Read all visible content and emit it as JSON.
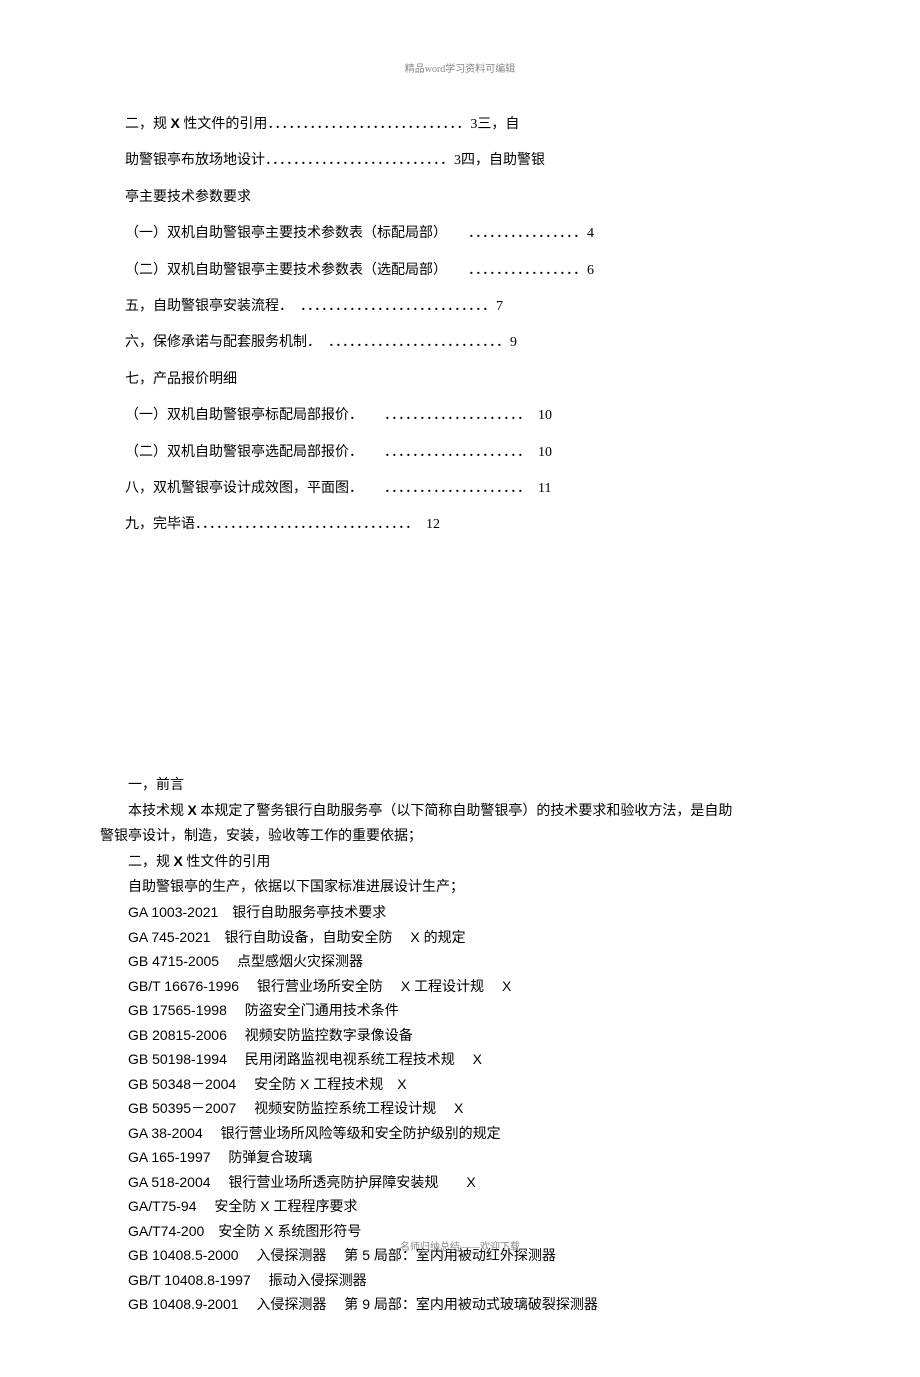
{
  "header": "精品word学习资料可编辑",
  "footer": "名师归纳总结——欢迎下载",
  "toc": {
    "flow1_a": "二，规 ",
    "flow1_x": "X",
    "flow1_b": " 性文件的引用．．．．．．．．．．．．．．．．．．．．．．．．．．．．3三，自",
    "flow2": "助警银亭布放场地设计．．．．．．．．．．．．．．．．．．．．．．．．．．3四，自助警银",
    "flow3": "亭主要技术参数要求",
    "item_a": "（一）双机自助警银亭主要技术参数表（标配局部）　　．．．．．．．．．．．．．．．．4",
    "item_b": "（二）双机自助警银亭主要技术参数表（选配局部）　　．．．．．．．．．．．．．．．．6",
    "item5": "五，自助警银亭安装流程．　．．．．．．．．．．．．．．．．．．．．．．．．．．．7",
    "item6": "六，保修承诺与配套服务机制．　．．．．．．．．．．．．．．．．．．．．．．．．．9",
    "item7": "七，产品报价明细",
    "item7a": "（一）双机自助警银亭标配局部报价．　　．．．．．．．．．．．．．．．．．．．．　10",
    "item7b": "（二）双机自助警银亭选配局部报价．　　．．．．．．．．．．．．．．．．．．．．　10",
    "item8": "八，双机警银亭设计成效图，平面图．　　．．．．．．．．．．．．．．．．．．．．　11",
    "item9": "九，完毕语．．．．．．．．．．．．．．．．．．．．．．．．．．．．．．．　12"
  },
  "body": {
    "h1": "一，前言",
    "p1_a": "本技术规 ",
    "p1_x": "X",
    "p1_b": " 本规定了警务银行自助服务亭（以下简称自助警银亭）的技术要求和验收方法，是自助",
    "p1_c": "警银亭设计，制造，安装，验收等工作的重要依据；",
    "h2_a": "二，规 ",
    "h2_x": "X",
    "h2_b": " 性文件的引用",
    "p2": "自助警银亭的生产，依据以下国家标准进展设计生产；",
    "standards": [
      "GA 1003-2021　银行自助服务亭技术要求",
      "GA 745-2021　银行自助设备，自助安全防　 X 的规定",
      "GB 4715-2005　 点型感烟火灾探测器",
      "GB/T 16676-1996　 银行营业场所安全防　 X 工程设计规　 X",
      "GB 17565-1998　 防盗安全门通用技术条件",
      "GB 20815-2006　 视频安防监控数字录像设备",
      "GB 50198-1994　 民用闭路监视电视系统工程技术规　 X",
      "GB 50348－2004　 安全防 X 工程技术规　X",
      "GB 50395－2007　 视频安防监控系统工程设计规　 X",
      "GA 38-2004　 银行营业场所风险等级和安全防护级别的规定",
      "GA 165-1997　 防弹复合玻璃",
      "GA 518-2004　 银行营业场所透亮防护屏障安装规　　X",
      "GA/T75-94　 安全防  X  工程程序要求",
      "GA/T74-200　安全防 X  系统图形符号",
      "GB 10408.5-2000　 入侵探测器　 第 5 局部：室内用被动红外探测器",
      "GB/T 10408.8-1997　 振动入侵探测器",
      "GB 10408.9-2001　 入侵探测器　 第 9 局部：室内用被动式玻璃破裂探测器"
    ]
  }
}
